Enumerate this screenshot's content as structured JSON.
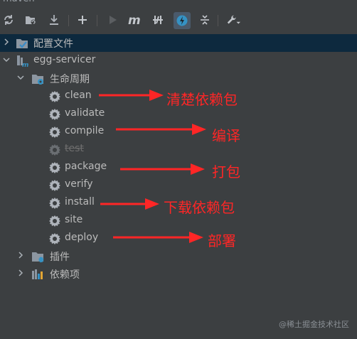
{
  "window": {
    "title": "maven"
  },
  "toolbar": {
    "buttons": [
      {
        "name": "reload-icon"
      },
      {
        "name": "generate-sources-icon"
      },
      {
        "name": "download-icon"
      },
      {
        "name": "add-icon"
      },
      {
        "name": "run-icon"
      },
      {
        "name": "execute-goal-icon"
      },
      {
        "name": "toggle-offline-icon"
      },
      {
        "name": "skip-tests-icon"
      },
      {
        "name": "collapse-all-icon"
      },
      {
        "name": "settings-wrench-icon"
      }
    ],
    "active_color": "#3592c4"
  },
  "tree": {
    "config_files": {
      "label": "配置文件"
    },
    "project": {
      "label": "egg-servicer"
    },
    "lifecycle": {
      "label": "生命周期",
      "phases": [
        {
          "label": "clean",
          "disabled": false
        },
        {
          "label": "validate",
          "disabled": false
        },
        {
          "label": "compile",
          "disabled": false
        },
        {
          "label": "test",
          "disabled": true
        },
        {
          "label": "package",
          "disabled": false
        },
        {
          "label": "verify",
          "disabled": false
        },
        {
          "label": "install",
          "disabled": false
        },
        {
          "label": "site",
          "disabled": false
        },
        {
          "label": "deploy",
          "disabled": false
        }
      ]
    },
    "plugins": {
      "label": "插件"
    },
    "dependencies": {
      "label": "依赖项"
    }
  },
  "annotations": {
    "clean": "清楚依赖包",
    "compile": "编译",
    "package": "打包",
    "install": "下载依赖包",
    "deploy": "部署",
    "color": "#ff2626"
  },
  "watermark": "@稀土掘金技术社区"
}
